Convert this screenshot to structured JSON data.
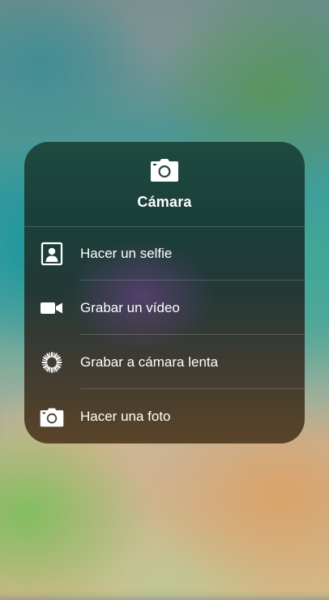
{
  "menu": {
    "title": "Cámara",
    "icon": "camera-icon",
    "actions": [
      {
        "label": "Hacer un selfie",
        "icon": "selfie-portrait-icon"
      },
      {
        "label": "Grabar un vídeo",
        "icon": "video-camera-icon"
      },
      {
        "label": "Grabar a cámara lenta",
        "icon": "slow-motion-icon"
      },
      {
        "label": "Hacer una foto",
        "icon": "camera-icon"
      }
    ]
  },
  "colors": {
    "text": "#ffffff",
    "menu_top": "#1e4a3f",
    "menu_bottom": "#5a4428"
  }
}
